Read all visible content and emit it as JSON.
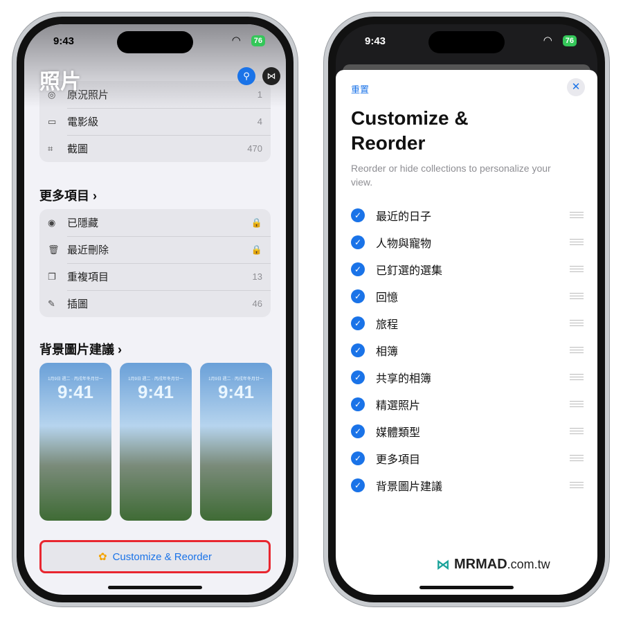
{
  "status": {
    "time": "9:43",
    "battery": "76"
  },
  "left": {
    "title": "照片",
    "media_rows": [
      {
        "icon": "live-photo-icon",
        "label": "原況照片",
        "count": "1"
      },
      {
        "icon": "cinematic-icon",
        "label": "電影級",
        "count": "4"
      },
      {
        "icon": "screenshot-icon",
        "label": "截圖",
        "count": "470"
      }
    ],
    "more_title": "更多項目",
    "more_rows": [
      {
        "icon": "eye-slash-icon",
        "label": "已隱藏",
        "count": ""
      },
      {
        "icon": "trash-icon",
        "label": "最近刪除",
        "count": ""
      },
      {
        "icon": "duplicate-icon",
        "label": "重複項目",
        "count": "13"
      },
      {
        "icon": "illustration-icon",
        "label": "插圖",
        "count": "46"
      }
    ],
    "wallpaper_title": "背景圖片建議",
    "wallpapers": [
      {
        "date": "1月9日 週二 · 丙戌年冬月廿一",
        "time": "9:41"
      },
      {
        "date": "1月9日 週二 · 丙戌年冬月廿一",
        "time": "9:41"
      },
      {
        "date": "1月9日 週二 · 丙戌年冬月廿一",
        "time": "9:41"
      }
    ],
    "customize_label": "Customize & Reorder"
  },
  "right": {
    "reset": "重置",
    "title": "Customize & Reorder",
    "subtitle": "Reorder or hide collections to personalize your view.",
    "items": [
      "最近的日子",
      "人物與寵物",
      "已釘選的選集",
      "回憶",
      "旅程",
      "相簿",
      "共享的相簿",
      "精選照片",
      "媒體類型",
      "更多項目",
      "背景圖片建議"
    ]
  },
  "watermark": {
    "brand": "MRMAD",
    "suffix": ".com.tw"
  },
  "colors": {
    "accent": "#1a73e8",
    "highlight": "#e8262f",
    "battery": "#34c759"
  }
}
